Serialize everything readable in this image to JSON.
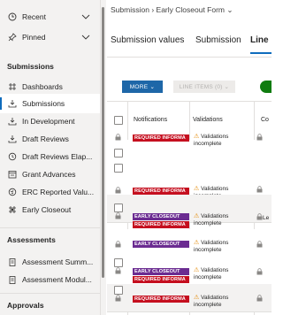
{
  "sidebar": {
    "top_items": [
      {
        "label": "Recent",
        "icon": "clock-icon"
      },
      {
        "label": "Pinned",
        "icon": "pin-icon"
      }
    ],
    "sections": [
      {
        "title": "Submissions"
      },
      {
        "title": "Assessments"
      },
      {
        "title": "Approvals"
      }
    ],
    "submissions_items": [
      {
        "label": "Dashboards",
        "icon": "dashboard-icon"
      },
      {
        "label": "Submissions",
        "icon": "submit-icon"
      },
      {
        "label": "In Development",
        "icon": "submit-icon"
      },
      {
        "label": "Draft Reviews",
        "icon": "submit-icon"
      },
      {
        "label": "Draft Reviews Elap...",
        "icon": "history-icon"
      },
      {
        "label": "Grant Advances",
        "icon": "calendar-icon"
      },
      {
        "label": "ERC Reported Valu...",
        "icon": "globe-icon"
      },
      {
        "label": "Early Closeout",
        "icon": "grid-icon"
      }
    ],
    "assessments_items": [
      {
        "label": "Assessment Summ...",
        "icon": "clipboard-icon"
      },
      {
        "label": "Assessment Modul...",
        "icon": "clipboard-icon"
      }
    ],
    "chevron": "chevron-down-icon"
  },
  "breadcrumb": {
    "part1": "Submission",
    "sep": "›",
    "part2": "Early Closeout Form",
    "chev": "⌄"
  },
  "tabs": [
    {
      "label": "Submission values"
    },
    {
      "label": "Submission"
    },
    {
      "label": "Line it"
    }
  ],
  "toolbar": {
    "more_label": "MORE ⌄",
    "line_items_label": "LINE ITEMS (0) ⌄"
  },
  "grid": {
    "headers": [
      "Notifications",
      "Validations",
      "Co"
    ],
    "rows": [
      {
        "badges": [
          "REQUIRED INFORMA"
        ],
        "badge_types": [
          "req"
        ],
        "validation_line1": "Validations",
        "validation_line2": "incomplete",
        "extra": ""
      },
      {
        "badges": [
          "REQUIRED INFORMA"
        ],
        "badge_types": [
          "req"
        ],
        "validation_line1": "Validations",
        "validation_line2": "incomplete",
        "extra": ""
      },
      {
        "badges": [
          "EARLY CLOSEOUT",
          "REQUIRED INFORMA"
        ],
        "badge_types": [
          "early",
          "req"
        ],
        "validation_line1": "Validations",
        "validation_line2": "incomplete",
        "extra": "Le"
      },
      {
        "badges": [
          "EARLY CLOSEOUT"
        ],
        "badge_types": [
          "early"
        ],
        "validation_line1": "Validations",
        "validation_line2": "incomplete",
        "extra": ""
      },
      {
        "badges": [
          "EARLY CLOSEOUT",
          "REQUIRED INFORMA"
        ],
        "badge_types": [
          "early",
          "req"
        ],
        "validation_line1": "Validations",
        "validation_line2": "incomplete",
        "extra": ""
      },
      {
        "badges": [
          "REQUIRED INFORMA"
        ],
        "badge_types": [
          "req"
        ],
        "validation_line1": "Validations",
        "validation_line2": "incomplete",
        "extra": ""
      }
    ]
  },
  "colors": {
    "accent": "#0f6cbd",
    "required": "#c50f1f",
    "early": "#6b2c91",
    "more_btn": "#1e67a8",
    "toggle": "#107c10"
  }
}
